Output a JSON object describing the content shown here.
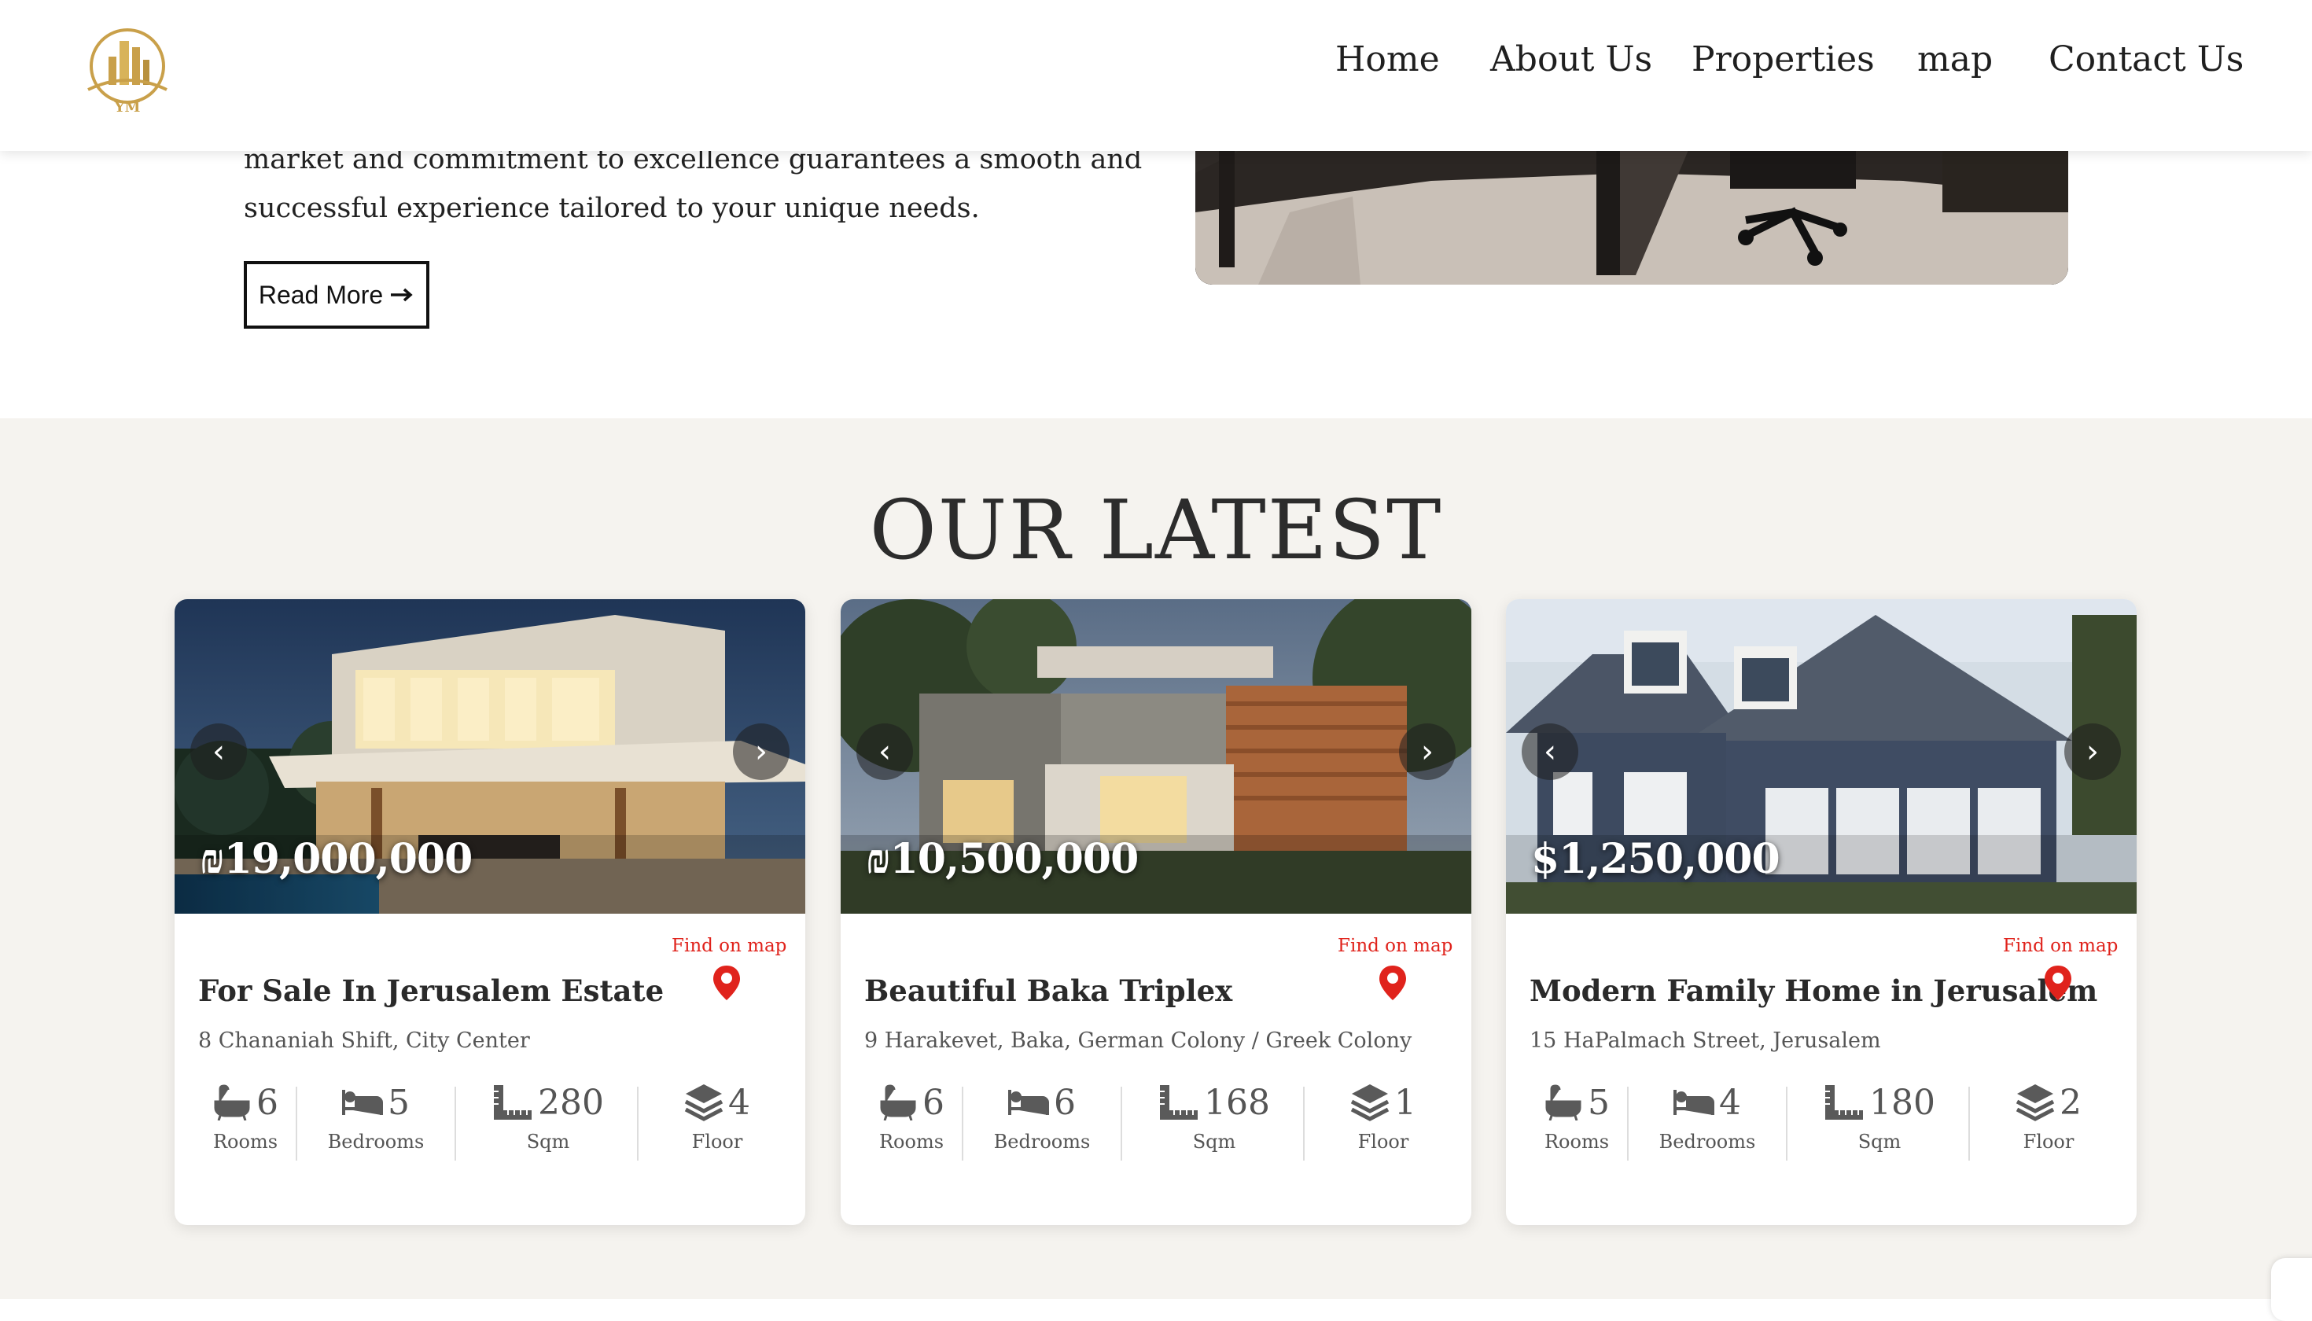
{
  "header": {
    "logo_text": "YM",
    "nav": [
      {
        "label": "Home"
      },
      {
        "label": "About Us"
      },
      {
        "label": "Properties"
      },
      {
        "label": "map"
      },
      {
        "label": "Contact Us"
      }
    ]
  },
  "about": {
    "line1": "market and commitment to excellence guarantees a smooth and",
    "line2": "successful experience tailored to your unique needs.",
    "read_more_label": "Read More",
    "read_more_icon": "arrow-right-icon"
  },
  "latest": {
    "title": "OUR LATEST",
    "find_on_map_label": "Find on map",
    "stat_labels": {
      "rooms": "Rooms",
      "bedrooms": "Bedrooms",
      "sqm": "Sqm",
      "floor": "Floor"
    },
    "cards": [
      {
        "price": "₪19,000,000",
        "title": "For Sale In Jerusalem Estate",
        "address": "8 Chananiah Shift, City Center",
        "rooms": "6",
        "bedrooms": "5",
        "sqm": "280",
        "floor": "4"
      },
      {
        "price": "₪10,500,000",
        "title": "Beautiful Baka Triplex",
        "address": "9 Harakevet, Baka, German Colony / Greek Colony",
        "rooms": "6",
        "bedrooms": "6",
        "sqm": "168",
        "floor": "1"
      },
      {
        "price": "$1,250,000",
        "title": "Modern Family Home in Jerusalem",
        "address": "15 HaPalmach Street, Jerusalem",
        "rooms": "5",
        "bedrooms": "4",
        "sqm": "180",
        "floor": "2"
      }
    ]
  },
  "colors": {
    "accent_red": "#e0231c",
    "section_bg": "#f5f3ef",
    "logo_gold": "#c9a04a"
  }
}
